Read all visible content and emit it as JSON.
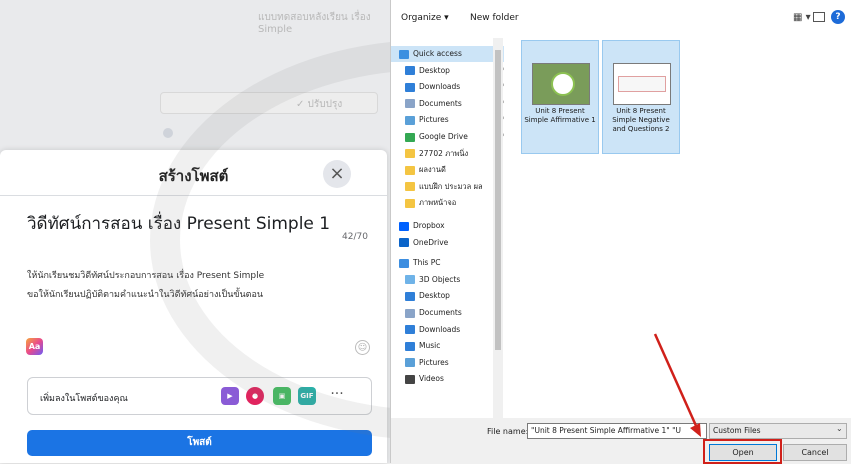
{
  "background": {
    "title": "แบบทดสอบหลังเรียน เรื่อง Simple",
    "pill_text": "✓ ปรับปรุง"
  },
  "modal": {
    "title": "สร้างโพสต์",
    "close_glyph": "×",
    "post_heading": "วิดีทัศน์การสอน เรื่อง Present Simple 1",
    "char_count": "42/70",
    "body_line1": "ให้นักเรียนชมวิดีทัศน์ประกอบการสอน เรื่อง Present Simple",
    "body_line2": "ขอให้นักเรียนปฏิบัติตามคำแนะนำในวิดีทัศน์อย่างเป็นขั้นตอน",
    "aa_label": "Aa",
    "add_to_post": "เพิ่มลงในโพสต์ของคุณ",
    "media_icons": {
      "video": "▶",
      "tag": "●",
      "photo": "▣",
      "gif": "GIF",
      "more": "···"
    },
    "post_button": "โพสต์"
  },
  "dialog": {
    "toolbar": {
      "organize": "Organize ▾",
      "new_folder": "New folder",
      "view": "▦ ▾",
      "help": "?"
    },
    "nav_items": [
      {
        "label": "Quick access",
        "icon": "star-icon",
        "color": "#3b8fe0",
        "pinned": false,
        "selected": true
      },
      {
        "label": "Desktop",
        "icon": "desktop-icon",
        "color": "#2f7fd8",
        "pinned": true,
        "selected": false
      },
      {
        "label": "Downloads",
        "icon": "download-icon",
        "color": "#2f7fd8",
        "pinned": true,
        "selected": false
      },
      {
        "label": "Documents",
        "icon": "document-icon",
        "color": "#8aa4c8",
        "pinned": true,
        "selected": false
      },
      {
        "label": "Pictures",
        "icon": "pictures-icon",
        "color": "#5aa0d8",
        "pinned": true,
        "selected": false
      },
      {
        "label": "Google Drive",
        "icon": "google-drive-icon",
        "color": "#34a853",
        "pinned": true,
        "selected": false
      },
      {
        "label": "27702 ภาพนิ่ง",
        "icon": "folder-icon",
        "color": "#f4c542",
        "pinned": false,
        "selected": false
      },
      {
        "label": "ผลงานดี",
        "icon": "folder-icon",
        "color": "#f4c542",
        "pinned": false,
        "selected": false
      },
      {
        "label": "แบบฝึก ประมวล ผล",
        "icon": "folder-icon",
        "color": "#f4c542",
        "pinned": false,
        "selected": false
      },
      {
        "label": "ภาพหน้าจอ",
        "icon": "folder-icon",
        "color": "#f4c542",
        "pinned": false,
        "selected": false
      },
      {
        "label": "Dropbox",
        "icon": "dropbox-icon",
        "color": "#0061fe",
        "pinned": false,
        "selected": false
      },
      {
        "label": "OneDrive",
        "icon": "onedrive-icon",
        "color": "#0a64c9",
        "pinned": false,
        "selected": false
      },
      {
        "label": "This PC",
        "icon": "this-pc-icon",
        "color": "#3d8ee0",
        "pinned": false,
        "selected": false
      },
      {
        "label": "3D Objects",
        "icon": "3d-objects-icon",
        "color": "#6fb3e8",
        "pinned": false,
        "selected": false
      },
      {
        "label": "Desktop",
        "icon": "desktop-icon",
        "color": "#2f7fd8",
        "pinned": false,
        "selected": false
      },
      {
        "label": "Documents",
        "icon": "document-icon",
        "color": "#8aa4c8",
        "pinned": false,
        "selected": false
      },
      {
        "label": "Downloads",
        "icon": "download-icon",
        "color": "#2f7fd8",
        "pinned": false,
        "selected": false
      },
      {
        "label": "Music",
        "icon": "music-icon",
        "color": "#2f7fd8",
        "pinned": false,
        "selected": false
      },
      {
        "label": "Pictures",
        "icon": "pictures-icon",
        "color": "#5aa0d8",
        "pinned": false,
        "selected": false
      },
      {
        "label": "Videos",
        "icon": "videos-icon",
        "color": "#444444",
        "pinned": false,
        "selected": false
      }
    ],
    "files": [
      {
        "label": "Unit 8 Present Simple Affirmative 1"
      },
      {
        "label": "Unit 8 Present Simple Negative and Questions 2"
      }
    ],
    "bottom": {
      "filename_label": "File name:",
      "filename_value": "\"Unit 8 Present Simple Affirmative 1\" \"U",
      "filetype": "Custom Files",
      "open": "Open",
      "cancel": "Cancel"
    }
  },
  "colors": {
    "facebook_blue": "#1b74e4",
    "selection": "#cce4f7",
    "highlight_red": "#d0201a"
  }
}
